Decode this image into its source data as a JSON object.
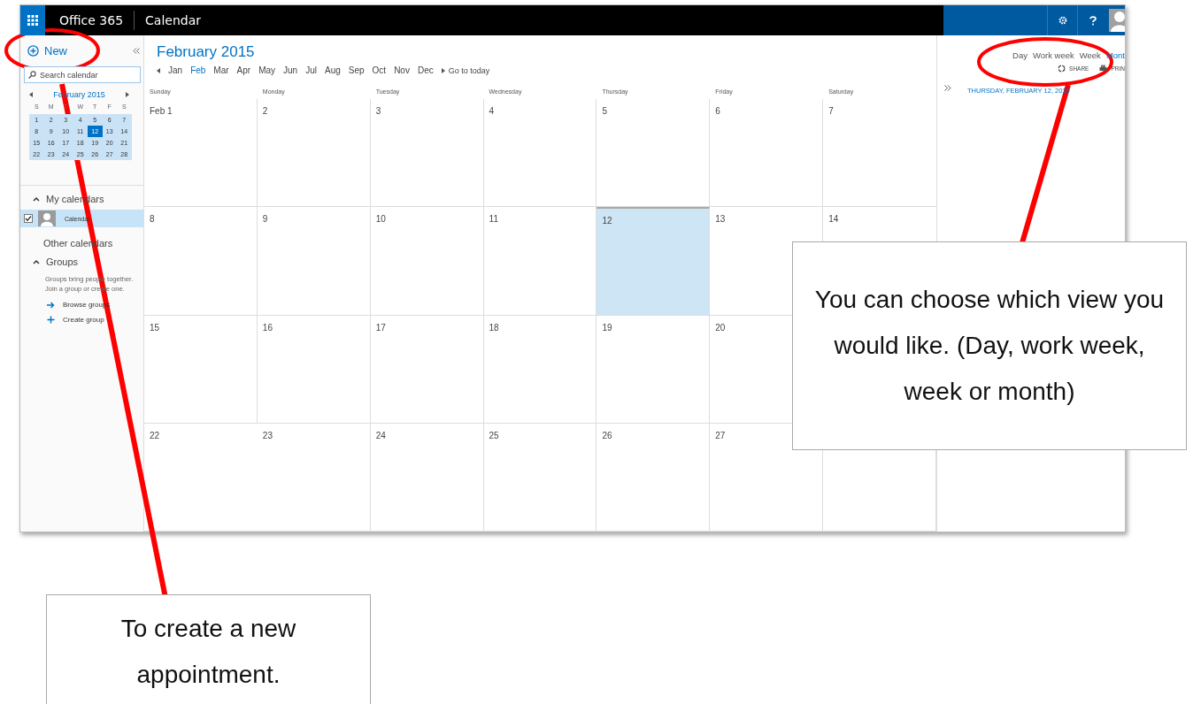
{
  "topbar": {
    "brand": "Office 365",
    "app": "Calendar"
  },
  "sidebar": {
    "new_label": "New",
    "search": {
      "placeholder": "Search calendar"
    },
    "mini_calendar": {
      "title": "February 2015",
      "weekdays": [
        "S",
        "M",
        "T",
        "W",
        "T",
        "F",
        "S"
      ],
      "weeks": [
        [
          {
            "day": "1",
            "selected": false
          },
          {
            "day": "2",
            "selected": false
          },
          {
            "day": "3",
            "selected": false
          },
          {
            "day": "4",
            "selected": false
          },
          {
            "day": "5",
            "selected": false
          },
          {
            "day": "6",
            "selected": false
          },
          {
            "day": "7",
            "selected": false
          }
        ],
        [
          {
            "day": "8",
            "selected": false
          },
          {
            "day": "9",
            "selected": false
          },
          {
            "day": "10",
            "selected": false
          },
          {
            "day": "11",
            "selected": false
          },
          {
            "day": "12",
            "selected": true
          },
          {
            "day": "13",
            "selected": false
          },
          {
            "day": "14",
            "selected": false
          }
        ],
        [
          {
            "day": "15",
            "selected": false
          },
          {
            "day": "16",
            "selected": false
          },
          {
            "day": "17",
            "selected": false
          },
          {
            "day": "18",
            "selected": false
          },
          {
            "day": "19",
            "selected": false
          },
          {
            "day": "20",
            "selected": false
          },
          {
            "day": "21",
            "selected": false
          }
        ],
        [
          {
            "day": "22",
            "selected": false
          },
          {
            "day": "23",
            "selected": false
          },
          {
            "day": "24",
            "selected": false
          },
          {
            "day": "25",
            "selected": false
          },
          {
            "day": "26",
            "selected": false
          },
          {
            "day": "27",
            "selected": false
          },
          {
            "day": "28",
            "selected": false
          }
        ]
      ]
    },
    "my_calendars": {
      "label": "My calendars",
      "expanded": true,
      "items": [
        {
          "name": "Calendar",
          "checked": true,
          "selected": true
        }
      ]
    },
    "other_calendars": "Other calendars",
    "groups": {
      "label": "Groups",
      "expanded": true,
      "description": "Groups bring people together. Join a group or create one.",
      "actions": [
        {
          "kind": "browse",
          "label": "Browse groups"
        },
        {
          "kind": "create",
          "label": "Create group"
        }
      ]
    }
  },
  "main": {
    "title": "February 2015",
    "months": [
      {
        "label": "Jan",
        "selected": false
      },
      {
        "label": "Feb",
        "selected": true
      },
      {
        "label": "Mar",
        "selected": false
      },
      {
        "label": "Apr",
        "selected": false
      },
      {
        "label": "May",
        "selected": false
      },
      {
        "label": "Jun",
        "selected": false
      },
      {
        "label": "Jul",
        "selected": false
      },
      {
        "label": "Aug",
        "selected": false
      },
      {
        "label": "Sep",
        "selected": false
      },
      {
        "label": "Oct",
        "selected": false
      },
      {
        "label": "Nov",
        "selected": false
      },
      {
        "label": "Dec",
        "selected": false
      }
    ],
    "go_to_today": "Go to today",
    "weekdays": [
      "Sunday",
      "Monday",
      "Tuesday",
      "Wednesday",
      "Thursday",
      "Friday",
      "Saturday"
    ],
    "weeks": [
      [
        {
          "day": "Feb 1",
          "selected": false
        },
        {
          "day": "2",
          "selected": false
        },
        {
          "day": "3",
          "selected": false
        },
        {
          "day": "4",
          "selected": false
        },
        {
          "day": "5",
          "selected": false
        },
        {
          "day": "6",
          "selected": false
        },
        {
          "day": "7",
          "selected": false
        }
      ],
      [
        {
          "day": "8",
          "selected": false
        },
        {
          "day": "9",
          "selected": false
        },
        {
          "day": "10",
          "selected": false
        },
        {
          "day": "11",
          "selected": false
        },
        {
          "day": "12",
          "selected": true
        },
        {
          "day": "13",
          "selected": false
        },
        {
          "day": "14",
          "selected": false
        }
      ],
      [
        {
          "day": "15",
          "selected": false
        },
        {
          "day": "16",
          "selected": false
        },
        {
          "day": "17",
          "selected": false
        },
        {
          "day": "18",
          "selected": false
        },
        {
          "day": "19",
          "selected": false
        },
        {
          "day": "20",
          "selected": false
        }
      ],
      [
        {
          "day": "22",
          "selected": false
        },
        {
          "day": "23",
          "selected": false
        },
        {
          "day": "24",
          "selected": false
        },
        {
          "day": "25",
          "selected": false
        },
        {
          "day": "26",
          "selected": false
        },
        {
          "day": "27",
          "selected": false
        },
        {
          "selected": false
        }
      ]
    ]
  },
  "views": [
    {
      "label": "Day",
      "selected": false
    },
    {
      "label": "Work week",
      "selected": false
    },
    {
      "label": "Week",
      "selected": false
    },
    {
      "label": "Mont",
      "selected": true
    }
  ],
  "actions": [
    {
      "kind": "share",
      "label": "SHARE"
    },
    {
      "kind": "print",
      "label": "PRIN"
    }
  ],
  "details_pane": {
    "date": "THURSDAY, FEBRUARY 12, 2015"
  },
  "callouts": [
    {
      "kind": "new",
      "text": "To create a new appointment."
    },
    {
      "kind": "views",
      "text": "You can choose which view you would like. (Day, work week, week or month)"
    }
  ]
}
